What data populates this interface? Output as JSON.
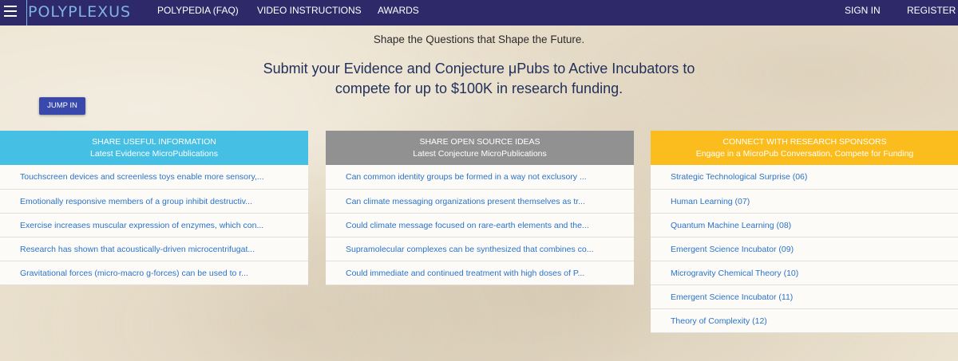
{
  "nav": {
    "brand": "POLYPLEXUS",
    "links": [
      "POLYPEDIA (FAQ)",
      "VIDEO INSTRUCTIONS",
      "AWARDS"
    ],
    "sign_in": "SIGN IN",
    "register": "REGISTER"
  },
  "hero": {
    "tagline": "Shape the Questions that Shape the Future.",
    "headline": "Submit your Evidence and Conjecture μPubs to Active Incubators to compete for up to $100K in research funding.",
    "cta": "JUMP IN"
  },
  "colors": {
    "navbar": "#2e2a6a",
    "evidence": "#45c0e4",
    "conjecture": "#919191",
    "sponsors": "#fbbd1d",
    "link": "#2a73c9"
  },
  "panels": [
    {
      "title": "SHARE USEFUL INFORMATION",
      "subtitle": "Latest Evidence MicroPublications",
      "items": [
        "Touchscreen devices and screenless toys enable more sensory,...",
        "Emotionally responsive members of a group inhibit destructiv...",
        "Exercise increases muscular expression of enzymes, which con...",
        "Research has shown that acoustically-driven microcentrifugat...",
        "Gravitational forces (micro-macro g-forces) can be used to r..."
      ]
    },
    {
      "title": "SHARE OPEN SOURCE IDEAS",
      "subtitle": "Latest Conjecture MicroPublications",
      "items": [
        "Can common identity groups be formed in a way not exclusory ...",
        "Can climate messaging organizations present themselves as tr...",
        "Could climate message focused on rare-earth elements and the...",
        "Supramolecular complexes can be synthesized that combines co...",
        "Could immediate and continued treatment with high doses of P..."
      ]
    },
    {
      "title": "CONNECT WITH RESEARCH SPONSORS",
      "subtitle": "Engage in a MicroPub Conversation, Compete for Funding",
      "items": [
        "Strategic Technological Surprise (06)",
        "Human Learning (07)",
        "Quantum Machine Learning (08)",
        "Emergent Science Incubator (09)",
        "Microgravity Chemical Theory (10)",
        "Emergent Science Incubator (11)",
        "Theory of Complexity (12)"
      ]
    }
  ]
}
